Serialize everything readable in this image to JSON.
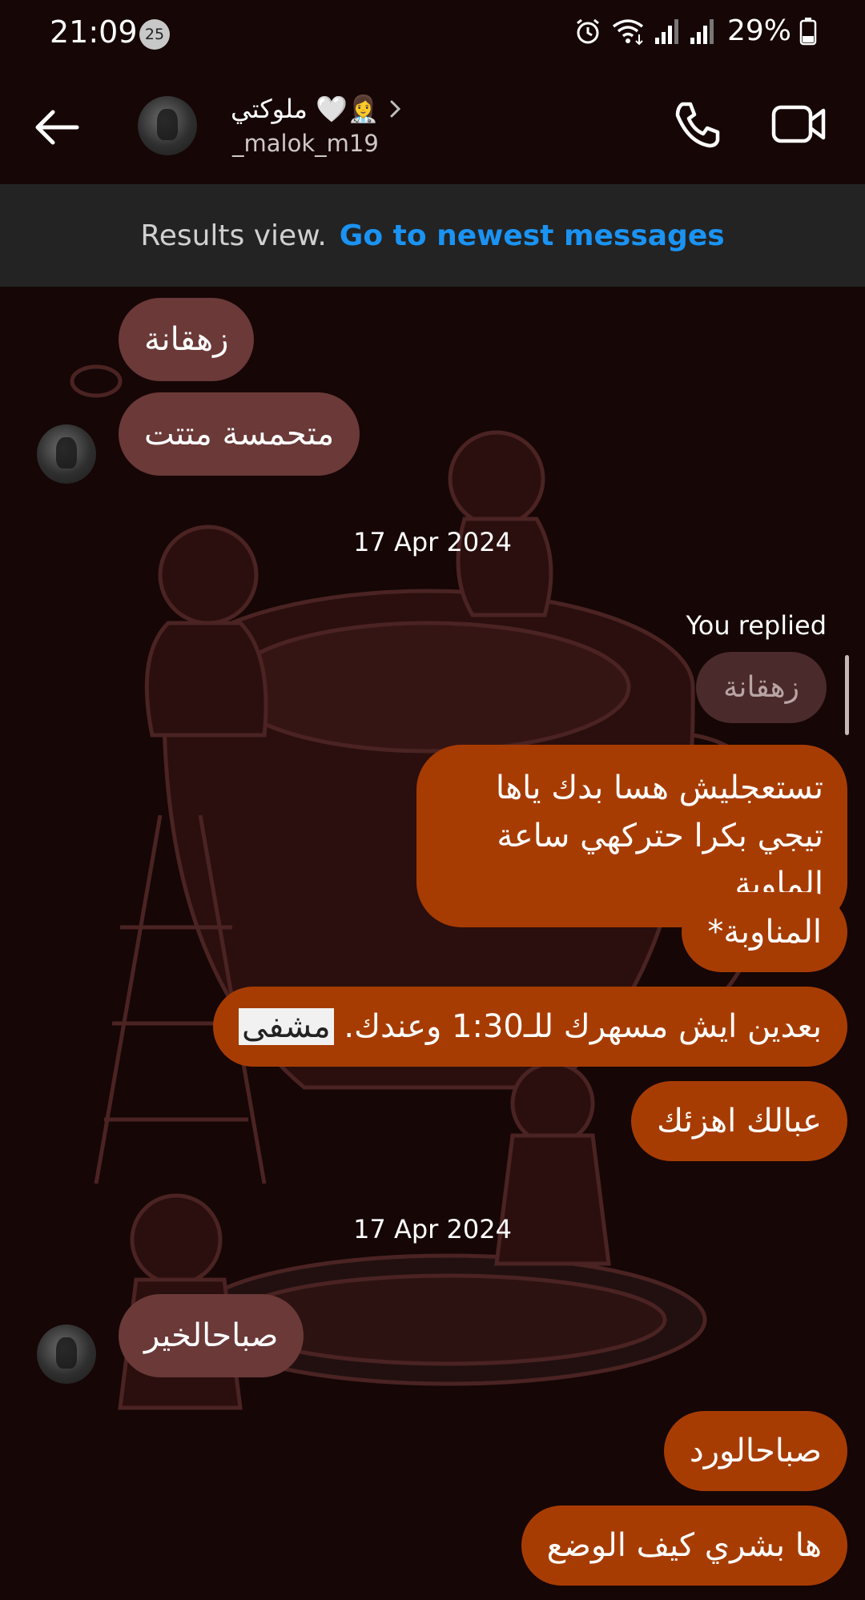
{
  "status_bar": {
    "time": "21:09",
    "notification_count": "25",
    "battery": "29%",
    "icons": [
      "alarm-icon",
      "wifi-icon",
      "signal-icon",
      "signal-icon-2",
      "battery-icon"
    ]
  },
  "header": {
    "name": "ملوكتي 🤍👩‍⚕️",
    "username": "_malok_m19",
    "icons": [
      "back-arrow-icon",
      "chevron-right-icon",
      "phone-icon",
      "video-camera-icon"
    ]
  },
  "results_banner": {
    "label": "Results view.",
    "link": "Go to newest messages"
  },
  "messages": {
    "m1": "زهقانة",
    "m2": "متحمسة متتت",
    "date1": "17 Apr 2024",
    "you_replied": "You replied",
    "quote": "زهقانة",
    "m3": "تستعجليش هسا بدك ياها تيجي بكرا حتركهي ساعة الماوبة",
    "m4": "المناوبة*",
    "m5_before": "بعدين ايش مسهرك للـ1:30 وعندك. ",
    "m5_highlight": "مشفى",
    "m6": "عبالك اهزئك",
    "date2": "17 Apr 2024",
    "m7": "صباحالخير",
    "m8": "صباحالورد",
    "m9": "ها بشري كيف الوضع"
  },
  "colors": {
    "background": "#160606",
    "incoming_bubble": "#6a3938",
    "outgoing_bubble": "#a73c02",
    "link": "#1a93f3",
    "banner": "#232323"
  }
}
